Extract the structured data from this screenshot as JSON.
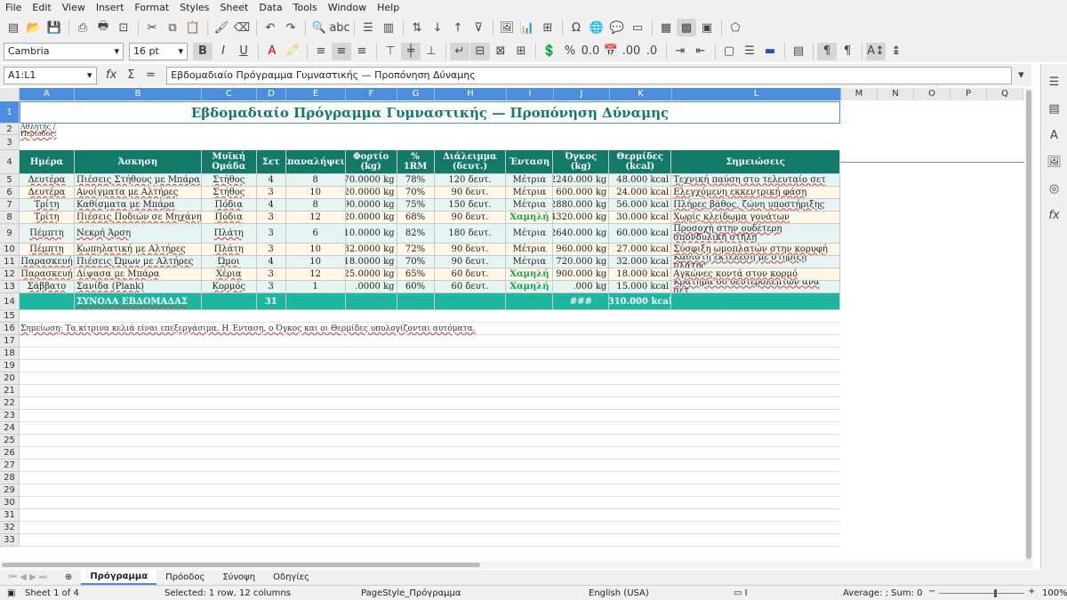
{
  "menu": [
    "File",
    "Edit",
    "View",
    "Insert",
    "Format",
    "Styles",
    "Sheet",
    "Data",
    "Tools",
    "Window",
    "Help"
  ],
  "font": {
    "name": "Cambria",
    "size": "16 pt"
  },
  "namebox": "A1:L1",
  "formula": "Εβδομαδιαίο Πρόγραμμα Γυμναστικής — Προπόνηση Δύναμης",
  "columns": [
    "A",
    "B",
    "C",
    "D",
    "E",
    "F",
    "G",
    "H",
    "I",
    "J",
    "K",
    "L",
    "M",
    "N",
    "O",
    "P",
    "Q"
  ],
  "title": "Εβδομαδιαίο Πρόγραμμα Γυμναστικής — Προπόνηση Δύναμης",
  "row2": {
    "a": "Αθλητής / Περίοδος:"
  },
  "headers": [
    "Ημέρα",
    "Άσκηση",
    "Μυϊκή Ομάδα",
    "Σετ",
    "Επαναλήψεις",
    "Φορτίο (kg)",
    "% 1RM",
    "Διάλειμμα (δευτ.)",
    "Ένταση",
    "Όγκος (kg)",
    "Θερμίδες (kcal)",
    "Σημειώσεις"
  ],
  "rows": [
    [
      "Δευτέρα",
      "Πιέσεις Στήθους με Μπάρα",
      "Στήθος",
      "4",
      "8",
      "70.0000 kg",
      "78%",
      "120 δευτ.",
      "Μέτρια",
      "2240.000 kg",
      "48.000 kcal",
      "Τεχνική παύση στο τελευταίο σετ"
    ],
    [
      "Δευτέρα",
      "Ανοίγματα με Αλτήρες",
      "Στήθος",
      "3",
      "10",
      "20.0000 kg",
      "70%",
      "90 δευτ.",
      "Μέτρια",
      "600.000 kg",
      "24.000 kcal",
      "Ελεγχόμενη εκκεντρική φάση"
    ],
    [
      "Τρίτη",
      "Καθίσματα με Μπάρα",
      "Πόδια",
      "4",
      "8",
      "90.0000 kg",
      "75%",
      "150 δευτ.",
      "Μέτρια",
      "2880.000 kg",
      "56.000 kcal",
      "Πλήρες βάθος, ζώνη υποστήριξης"
    ],
    [
      "Τρίτη",
      "Πιέσεις Ποδιών σε Μηχάνημα",
      "Πόδια",
      "3",
      "12",
      "120.0000 kg",
      "68%",
      "90 δευτ.",
      "Χαμηλή",
      "4320.000 kg",
      "30.000 kcal",
      "Χωρίς κλείδωμα γονάτων"
    ],
    [
      "Πέμπτη",
      "Νεκρή Άρση",
      "Πλάτη",
      "3",
      "6",
      "110.0000 kg",
      "82%",
      "180 δευτ.",
      "Μέτρια",
      "2640.000 kg",
      "60.000 kcal",
      "Προσοχή στην ουδέτερη σπονδυλική στήλη"
    ],
    [
      "Πέμπτη",
      "Κωπηλατική με Αλτήρες",
      "Πλάτη",
      "3",
      "10",
      "32.0000 kg",
      "72%",
      "90 δευτ.",
      "Μέτρια",
      "960.000 kg",
      "27.000 kcal",
      "Σύσφιξη ωμοπλατών στην κορυφή"
    ],
    [
      "Παρασκευή",
      "Πιέσεις Ώμων με Αλτήρες",
      "Ώμοι",
      "4",
      "10",
      "18.0000 kg",
      "70%",
      "90 δευτ.",
      "Μέτρια",
      "720.000 kg",
      "32.000 kcal",
      "Καθιστή εκτέλεση με στήριξη πλάτης"
    ],
    [
      "Παρασκευή",
      "Δίψασα με Μπάρα",
      "Χέρια",
      "3",
      "12",
      "25.0000 kg",
      "65%",
      "60 δευτ.",
      "Χαμηλή",
      "900.000 kg",
      "18.000 kcal",
      "Αγκώνες κοντά στον κορμό"
    ],
    [
      "Σάββατο",
      "Σανίδα (Plank)",
      "Κορμός",
      "3",
      "1",
      ".0000 kg",
      "60%",
      "60 δευτ.",
      "Χαμηλή",
      ".000 kg",
      "15.000 kcal",
      "Κράτημα 60 δευτερολέπτων ανά σετ"
    ]
  ],
  "totals": {
    "label": "ΣΥΝΟΛΑ ΕΒΔΟΜΑΔΑΣ",
    "sets": "31",
    "volume": "###",
    "kcal": "310.000 kcal"
  },
  "note": "Σημείωση: Τα κίτρινα κελιά είναι επεξεργάσιμα. Η Ένταση, ο Όγκος και οι Θερμίδες υπολογίζονται αυτόματα.",
  "tabs": [
    "Πρόγραμμα",
    "Πρόοδος",
    "Σύνοψη",
    "Οδηγίες"
  ],
  "status": {
    "sheet": "Sheet 1 of 4",
    "selected": "Selected: 1 row, 12 columns",
    "pagestyle": "PageStyle_Πρόγραμμα",
    "lang": "English (USA)",
    "sum": "Average: ; Sum: 0",
    "zoom": "100%"
  }
}
